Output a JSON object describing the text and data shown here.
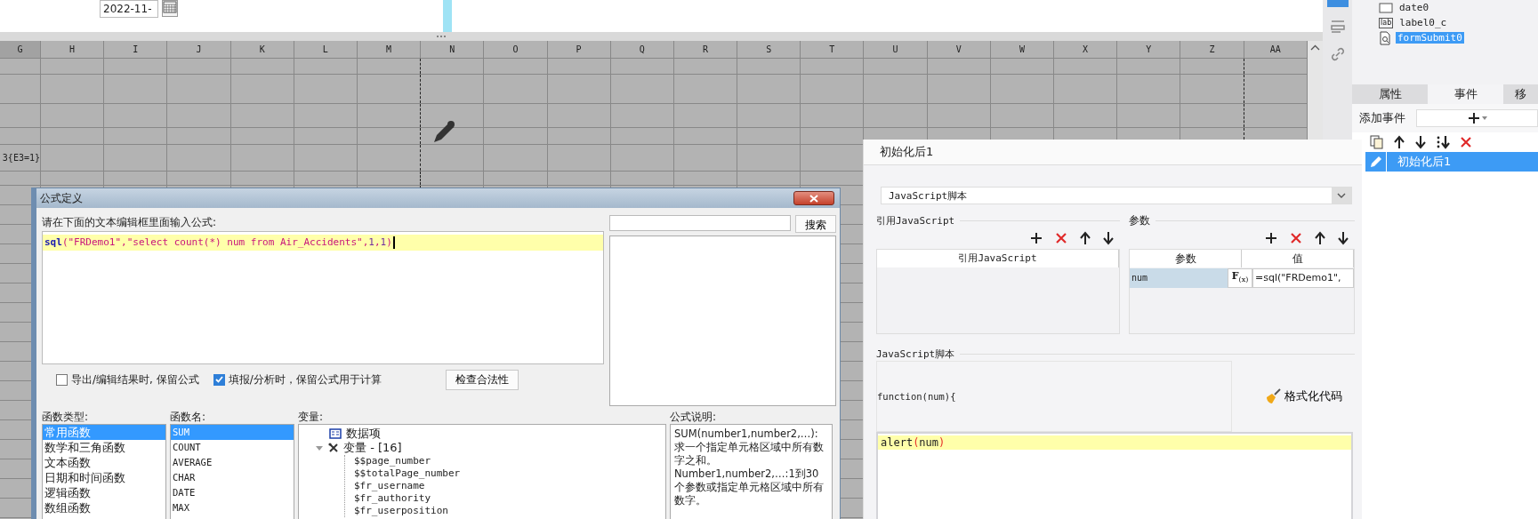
{
  "top_form": {
    "date_field": "2022-11-"
  },
  "sheet": {
    "columns": [
      "G",
      "H",
      "I",
      "J",
      "K",
      "L",
      "M",
      "N",
      "O",
      "P",
      "Q",
      "R",
      "S",
      "T",
      "U",
      "V",
      "W",
      "X",
      "Y",
      "Z",
      "AA"
    ],
    "formula_cell": "3{E3=1}"
  },
  "side_panel": {
    "tree": [
      {
        "label": "date0",
        "kind": "date",
        "selected": false
      },
      {
        "label": "label0_c",
        "kind": "label",
        "icon_text": "lab",
        "selected": false
      },
      {
        "label": "formSubmit0",
        "kind": "submit",
        "selected": true
      }
    ],
    "tabs": [
      {
        "label": "属性",
        "selected": false
      },
      {
        "label": "事件",
        "selected": true
      },
      {
        "label": "移",
        "selected": false
      }
    ],
    "add_event_label": "添加事件",
    "events": [
      {
        "label": "初始化后1",
        "selected": true
      }
    ]
  },
  "formula_dialog": {
    "title": "公式定义",
    "prompt": "请在下面的文本编辑框里面输入公式:",
    "formula_tokens": [
      {
        "kind": "function",
        "text": "sql"
      },
      {
        "kind": "paren",
        "text": "("
      },
      {
        "kind": "string",
        "text": "\"FRDemo1\""
      },
      {
        "kind": "punct",
        "text": ","
      },
      {
        "kind": "string",
        "text": "\"select count(*) num from Air_Accidents\""
      },
      {
        "kind": "punct",
        "text": ","
      },
      {
        "kind": "number",
        "text": "1"
      },
      {
        "kind": "punct",
        "text": ","
      },
      {
        "kind": "number",
        "text": "1"
      },
      {
        "kind": "paren",
        "text": ")"
      }
    ],
    "search_button": "搜索",
    "options": [
      {
        "label": "导出/编辑结果时, 保留公式",
        "checked": false
      },
      {
        "label": "填报/分析时，保留公式用于计算",
        "checked": true
      }
    ],
    "check_button": "检查合法性",
    "function_types": {
      "label": "函数类型:",
      "items": [
        {
          "label": "常用函数",
          "selected": true
        },
        {
          "label": "数学和三角函数",
          "selected": false
        },
        {
          "label": "文本函数",
          "selected": false
        },
        {
          "label": "日期和时间函数",
          "selected": false
        },
        {
          "label": "逻辑函数",
          "selected": false
        },
        {
          "label": "数组函数",
          "selected": false
        }
      ]
    },
    "function_names": {
      "label": "函数名:",
      "items": [
        {
          "label": "SUM",
          "selected": true
        },
        {
          "label": "COUNT",
          "selected": false
        },
        {
          "label": "AVERAGE",
          "selected": false
        },
        {
          "label": "CHAR",
          "selected": false
        },
        {
          "label": "DATE",
          "selected": false
        },
        {
          "label": "MAX",
          "selected": false
        }
      ]
    },
    "variables": {
      "label": "变量:",
      "tree": [
        {
          "label": "数据项",
          "kind": "dataset"
        },
        {
          "label": "变量 - [16]",
          "kind": "group",
          "expanded": true,
          "children": [
            {
              "label": "$$page_number"
            },
            {
              "label": "$$totalPage_number"
            },
            {
              "label": "$fr_username"
            },
            {
              "label": "$fr_authority"
            },
            {
              "label": "$fr_userposition"
            }
          ]
        }
      ]
    },
    "description": {
      "label": "公式说明:",
      "paragraphs": [
        "SUM(number1,number2,…): 求一个指定单元格区域中所有数字之和。",
        "Number1,number2,…:1到30个参数或指定单元格区域中所有数字。"
      ]
    }
  },
  "event_dialog": {
    "title": "初始化后1",
    "script_type": "JavaScript脚本",
    "ref_section": {
      "title": "引用JavaScript",
      "column": "引用JavaScript"
    },
    "params_section": {
      "title": "参数",
      "columns": [
        "参数",
        "值"
      ],
      "rows": [
        {
          "name": "num",
          "formula_button": "F$_{(x)}$",
          "value": "=sql(\"FRDemo1\","
        }
      ]
    },
    "script_section_title": "JavaScript脚本",
    "function_header": "function(num){",
    "format_button": "格式化代码",
    "code_tokens": [
      {
        "kind": "identifier",
        "text": "alert"
      },
      {
        "kind": "paren",
        "text": "("
      },
      {
        "kind": "identifier",
        "text": "num"
      },
      {
        "kind": "paren",
        "text": ")"
      }
    ]
  }
}
